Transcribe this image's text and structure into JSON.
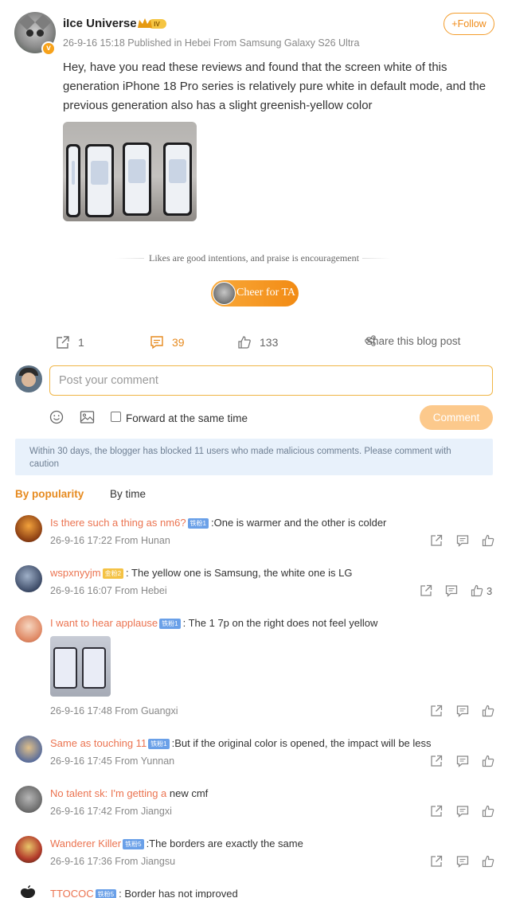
{
  "post": {
    "username": "iIce Universe",
    "level_badge": "IV",
    "verified_mark": "v",
    "meta": "26-9-16 15:18 Published in Hebei From Samsung Galaxy S26 Ultra",
    "follow_label": "+Follow",
    "text": "Hey, have you read these reviews and found that the screen white of this generation iPhone 18 Pro series is relatively pure white in default mode, and the previous generation also has a slight greenish-yellow color",
    "image_icon": "phones-comparison-photo"
  },
  "cheer": {
    "caption": "Likes are good intentions, and praise is encouragement",
    "button_label": "Cheer for TA"
  },
  "actions": {
    "forward_count": "1",
    "comment_count": "39",
    "like_count": "133",
    "share_label": "Share this blog post"
  },
  "compose": {
    "placeholder": "Post your comment",
    "forward_label": "Forward at the same time",
    "comment_button": "Comment"
  },
  "notice": "Within 30 days, the blogger has blocked 11 users who made malicious comments. Please comment with caution",
  "sort": {
    "popularity": "By popularity",
    "time": "By time"
  },
  "comments": [
    {
      "user": "Is there such a thing as nm6?",
      "badge": "铁粉1",
      "text": ":One  is warmer and the other is colder",
      "meta": "26-9-16 17:22 From Hunan",
      "likes": ""
    },
    {
      "user": "wspxnyyjm",
      "badge": "金粉2",
      "text": ": The yellow one is Samsung, the white one is LG",
      "meta": "26-9-16 16:07 From Hebei",
      "likes": "3"
    },
    {
      "user": "I want to hear applause",
      "badge": "铁粉1",
      "text": ": The 1 7p on the right does not feel yellow",
      "meta": "26-9-16 17:48 From Guangxi",
      "likes": ""
    },
    {
      "user": "Same as touching 11",
      "badge": "铁粉1",
      "text": ":But if the  original color is opened, the impact will be less",
      "meta": "26-9-16 17:45 From Yunnan",
      "likes": ""
    },
    {
      "user": "No talent sk: I'm getting a",
      "badge": "",
      "text": " new cmf",
      "meta": "26-9-16 17:42 From Jiangxi",
      "likes": ""
    },
    {
      "user": "Wanderer Killer",
      "badge": "铁粉5",
      "text": ":The borders are  exactly the same",
      "meta": "26-9-16 17:36 From Jiangsu",
      "likes": ""
    },
    {
      "user": "TTOCOC",
      "badge": "铁粉5",
      "text": ": Border has not improved",
      "meta": "",
      "likes": ""
    }
  ],
  "colors": {
    "accent": "#f08b18",
    "username": "#eb7350",
    "notice_bg": "#e8f1fb",
    "fan_badge": "#6aa0e8"
  }
}
